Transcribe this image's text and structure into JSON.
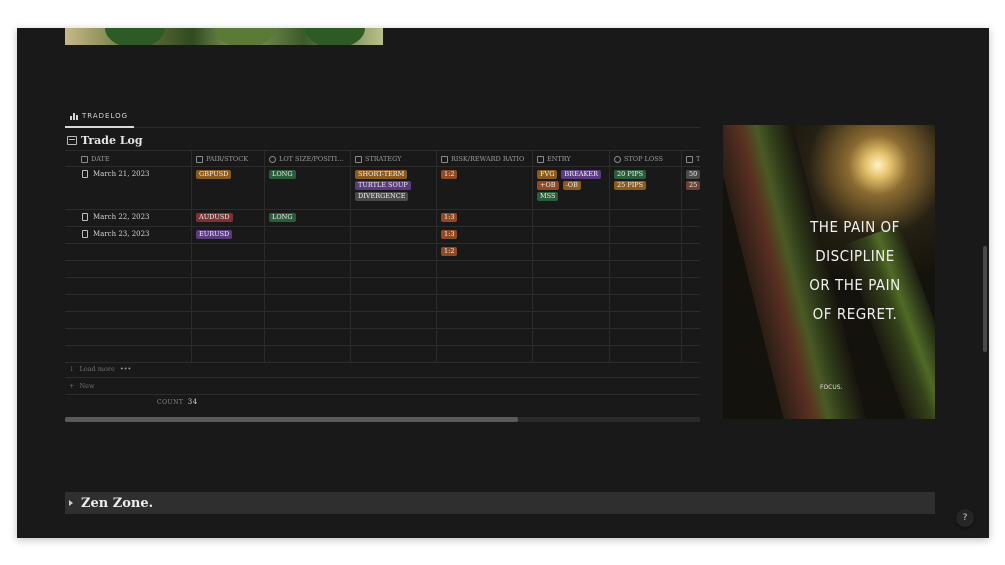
{
  "tab": {
    "label": "TRADELOG",
    "icon": "bar-chart-icon"
  },
  "database": {
    "title": "Trade Log",
    "icon": "table-icon"
  },
  "columns": [
    {
      "label": "DATE",
      "icon": "calendar-icon"
    },
    {
      "label": "PAIR/STOCK",
      "icon": "list-icon"
    },
    {
      "label": "LOT SIZE/POSITI...",
      "icon": "select-icon"
    },
    {
      "label": "STRATEGY",
      "icon": "list-icon"
    },
    {
      "label": "RISK/REWARD RATIO",
      "icon": "formula-icon"
    },
    {
      "label": "ENTRY",
      "icon": "list-icon"
    },
    {
      "label": "STOP LOSS",
      "icon": "select-icon"
    },
    {
      "label": "T",
      "icon": "number-icon"
    }
  ],
  "rows": [
    {
      "date": "March 21, 2023",
      "pair": [
        "GBPUSD"
      ],
      "lot": [
        "LONG"
      ],
      "strategy": [
        "SHORT-TERM",
        "TURTLE SOUP",
        "DIVERGENCE"
      ],
      "rr": [
        "1:2"
      ],
      "entry": [
        "FVG",
        "BREAKER",
        "+OB",
        "-OB",
        "MSS"
      ],
      "stop": [
        "20 PIPS",
        "25 PIPS"
      ],
      "t": [
        "50",
        "25"
      ]
    },
    {
      "date": "March 22, 2023",
      "pair": [
        "AUDUSD"
      ],
      "lot": [
        "LONG"
      ],
      "strategy": [],
      "rr": [
        "1:3"
      ],
      "entry": [],
      "stop": [],
      "t": []
    },
    {
      "date": "March 23, 2023",
      "pair": [
        "EURUSD"
      ],
      "lot": [],
      "strategy": [],
      "rr": [
        "1:3"
      ],
      "entry": [],
      "stop": [],
      "t": []
    },
    {
      "date": "",
      "pair": [],
      "lot": [],
      "strategy": [],
      "rr": [
        "1:2"
      ],
      "entry": [],
      "stop": [],
      "t": []
    }
  ],
  "footer": {
    "load_more": "Load more",
    "new": "New",
    "count_label": "COUNT",
    "count_value": "34"
  },
  "poster": {
    "lines": [
      "THE PAIN OF",
      "DISCIPLINE",
      "OR THE PAIN",
      "OF REGRET."
    ],
    "signature": "FOCUS."
  },
  "toggle": {
    "title": "Zen Zone."
  },
  "help": "?",
  "colors": {
    "background": "#191919",
    "toggle_bg": "#2f2f2f",
    "orange": "#8a5a1f",
    "purple": "#5a3b80",
    "green": "#2b5d3b",
    "brown": "#6b4231"
  }
}
